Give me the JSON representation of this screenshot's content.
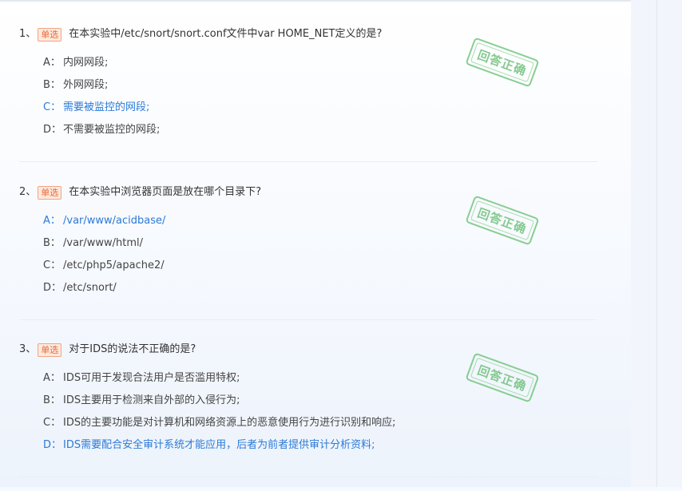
{
  "questions": [
    {
      "number": "1、",
      "type": "单选",
      "text": "在本实验中/etc/snort/snort.conf文件中var HOME_NET定义的是?",
      "stamp": "回答正确",
      "options": [
        {
          "letter": "A：",
          "text": "内网网段;",
          "correct": false
        },
        {
          "letter": "B：",
          "text": "外网网段;",
          "correct": false
        },
        {
          "letter": "C：",
          "text": "需要被监控的网段;",
          "correct": true
        },
        {
          "letter": "D：",
          "text": "不需要被监控的网段;",
          "correct": false
        }
      ]
    },
    {
      "number": "2、",
      "type": "单选",
      "text": "在本实验中浏览器页面是放在哪个目录下?",
      "stamp": "回答正确",
      "options": [
        {
          "letter": "A：",
          "text": "/var/www/acidbase/",
          "correct": true
        },
        {
          "letter": "B：",
          "text": "/var/www/html/",
          "correct": false
        },
        {
          "letter": "C：",
          "text": "/etc/php5/apache2/",
          "correct": false
        },
        {
          "letter": "D：",
          "text": "/etc/snort/",
          "correct": false
        }
      ]
    },
    {
      "number": "3、",
      "type": "单选",
      "text": "对于IDS的说法不正确的是?",
      "stamp": "回答正确",
      "options": [
        {
          "letter": "A：",
          "text": "IDS可用于发现合法用户是否滥用特权;",
          "correct": false
        },
        {
          "letter": "B：",
          "text": "IDS主要用于检测来自外部的入侵行为;",
          "correct": false
        },
        {
          "letter": "C：",
          "text": "IDS的主要功能是对计算机和网络资源上的恶意使用行为进行识别和响应;",
          "correct": false
        },
        {
          "letter": "D：",
          "text": "IDS需要配合安全审计系统才能应用，后者为前者提供审计分析资料;",
          "correct": true
        }
      ]
    }
  ],
  "colors": {
    "correct_option": "#2b7ad7",
    "stamp_green": "#6fc27b",
    "type_badge": "#ea6a39"
  }
}
